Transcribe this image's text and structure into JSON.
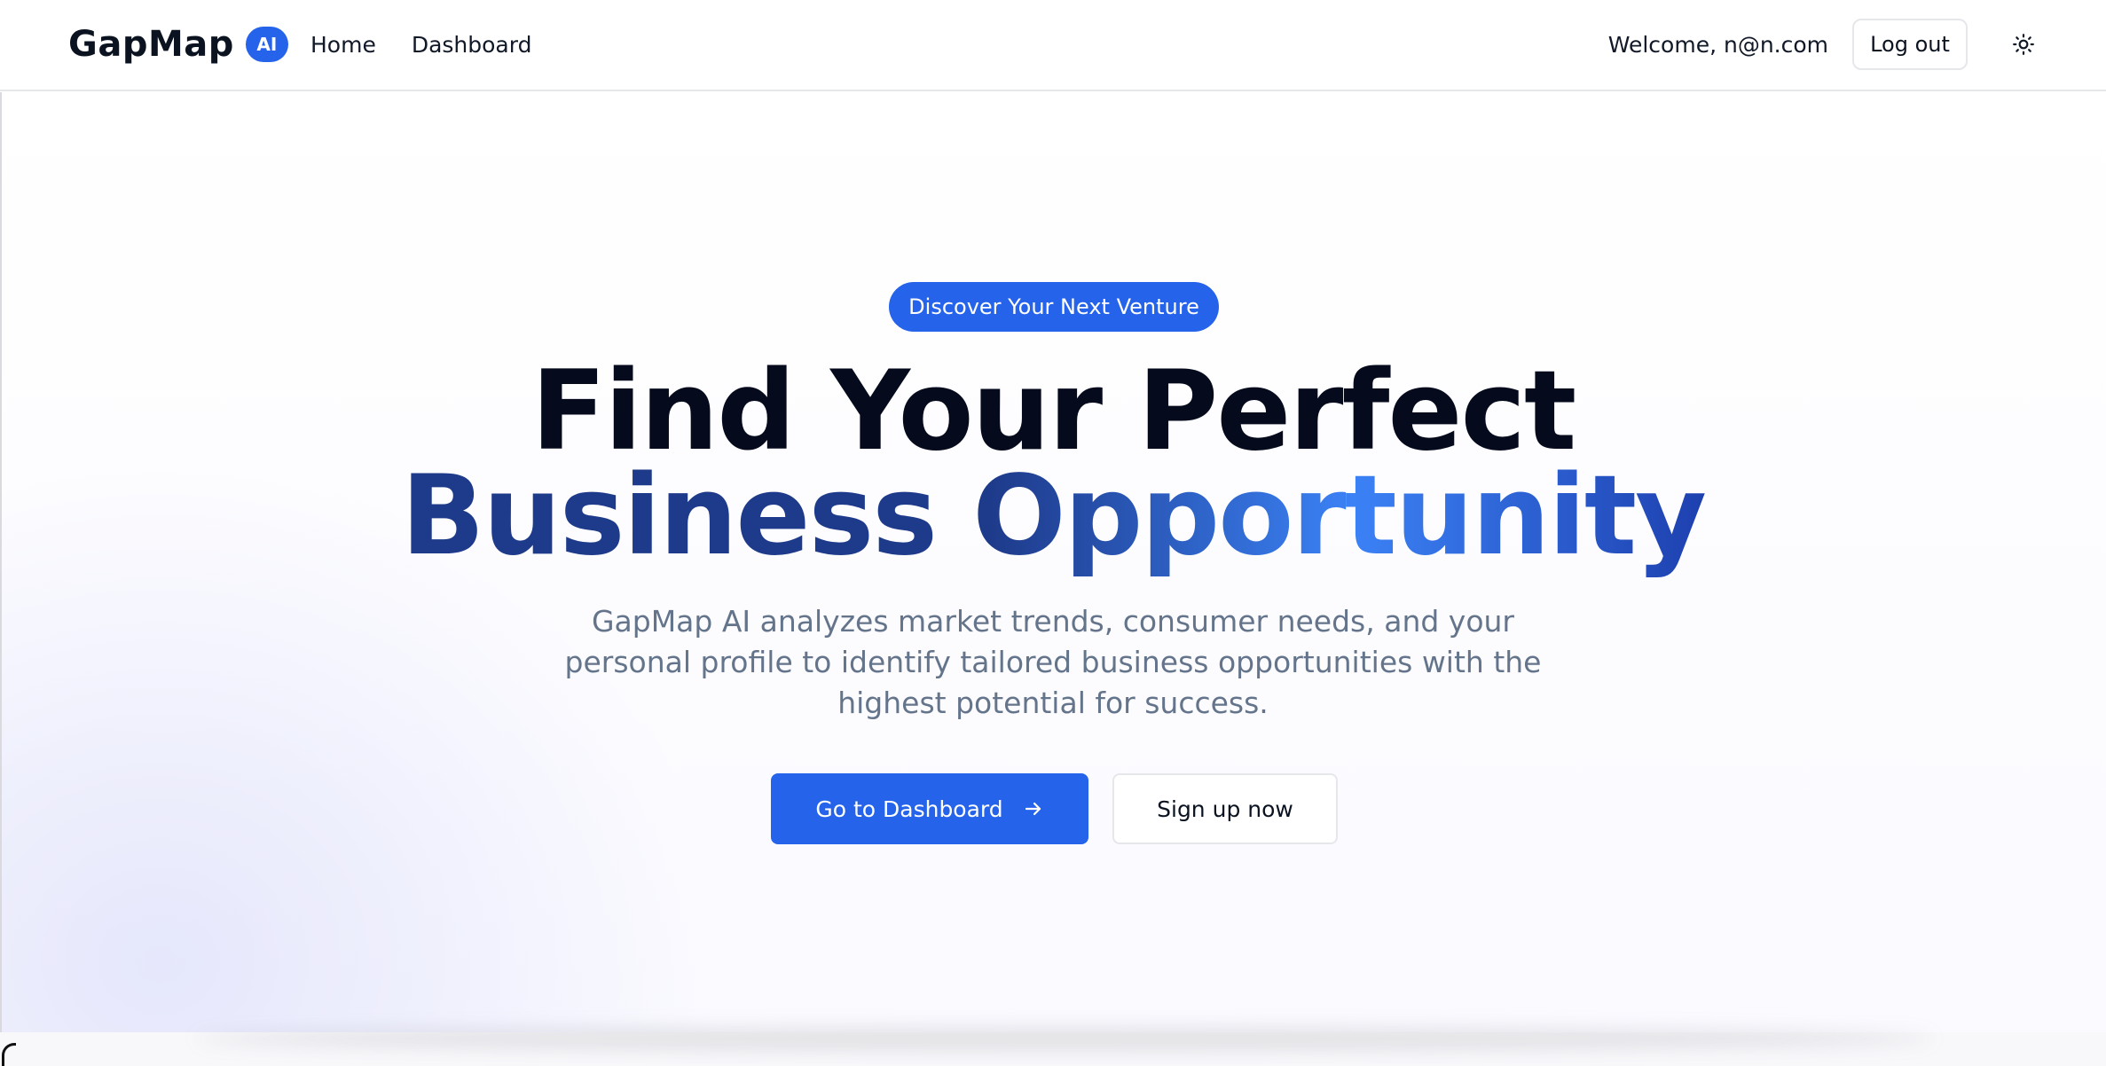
{
  "header": {
    "brand_name": "GapMap",
    "brand_badge": "AI",
    "nav": [
      {
        "label": "Home"
      },
      {
        "label": "Dashboard"
      }
    ],
    "welcome_text": "Welcome, n@n.com",
    "logout_label": "Log out",
    "theme_icon": "sun-icon"
  },
  "hero": {
    "pill_label": "Discover Your Next Venture",
    "headline_line1": "Find Your Perfect",
    "headline_line2": "Business Opportunity",
    "subtitle": "GapMap AI analyzes market trends, consumer needs, and your personal profile to identify tailored business opportunities with the highest potential for success.",
    "primary_cta": "Go to Dashboard",
    "primary_cta_icon": "arrow-right-icon",
    "secondary_cta": "Sign up now"
  },
  "colors": {
    "accent": "#2563eb",
    "headline_dark": "#050b1d",
    "headline_gradient_start": "#1e3a8a",
    "headline_gradient_mid": "#3b82f6",
    "subtitle": "#64748b"
  }
}
